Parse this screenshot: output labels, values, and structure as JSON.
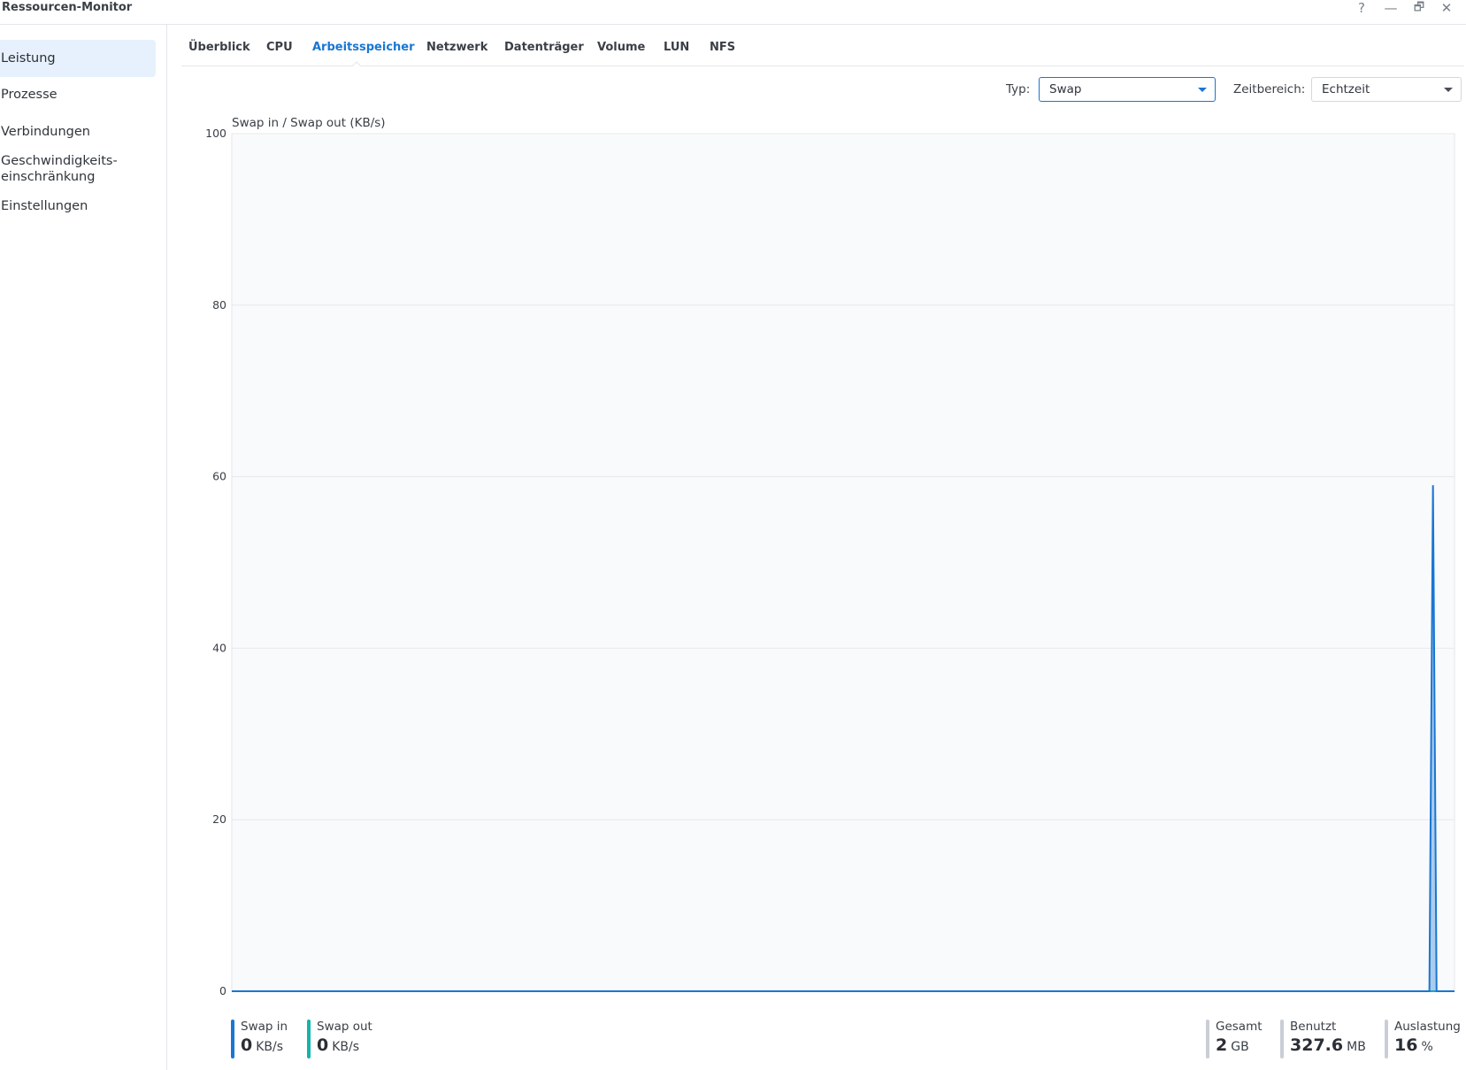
{
  "window": {
    "title": "Ressourcen-Monitor",
    "controls": {
      "help": "?",
      "minimize": "—",
      "restore": "🗗",
      "close": "✕"
    }
  },
  "sidebar": {
    "items": [
      {
        "label": "Leistung",
        "active": true
      },
      {
        "label": "Prozesse"
      },
      {
        "label": "Verbindungen"
      },
      {
        "label": "Geschwindigkeits-\neinschränkung"
      },
      {
        "label": "Einstellungen"
      }
    ]
  },
  "tabs": [
    {
      "label": "Überblick"
    },
    {
      "label": "CPU"
    },
    {
      "label": "Arbeitsspeicher",
      "active": true
    },
    {
      "label": "Netzwerk"
    },
    {
      "label": "Datenträger"
    },
    {
      "label": "Volume"
    },
    {
      "label": "LUN"
    },
    {
      "label": "NFS"
    }
  ],
  "filters": {
    "type_label": "Typ:",
    "type_value": "Swap",
    "range_label": "Zeitbereich:",
    "range_value": "Echtzeit"
  },
  "chart_data": {
    "type": "area",
    "title": "Swap in / Swap out (KB/s)",
    "ylim": [
      0,
      100
    ],
    "yticks": [
      0,
      20,
      40,
      60,
      80,
      100
    ],
    "grid": true,
    "series": [
      {
        "name": "Swap in",
        "color": "#1a76d2",
        "values": [
          0,
          0,
          0,
          0,
          0,
          0,
          0,
          0,
          0,
          0,
          0,
          0,
          0,
          0,
          0,
          0,
          0,
          0,
          0,
          0,
          0,
          0,
          0,
          0,
          0,
          0,
          0,
          0,
          0,
          0,
          0,
          0,
          0,
          0,
          0,
          0,
          0,
          0,
          0,
          0,
          0,
          0,
          0,
          0,
          0,
          0,
          0,
          0,
          0,
          0,
          0,
          0,
          0,
          0,
          0,
          0,
          0,
          0,
          0,
          0,
          0,
          0,
          0,
          0,
          0,
          0,
          0,
          0,
          0,
          0,
          0,
          0,
          0,
          0,
          0,
          0,
          0,
          0,
          0,
          0,
          0,
          0,
          0,
          0,
          0,
          0,
          0,
          0,
          0,
          0,
          0,
          0,
          0,
          0,
          0,
          0,
          0,
          0,
          0,
          0,
          0,
          0,
          0,
          0,
          0,
          0,
          0,
          0,
          0,
          0,
          0,
          0,
          0,
          0,
          0,
          0,
          0,
          0,
          0,
          0,
          0,
          0,
          0,
          0,
          0,
          0,
          0,
          0,
          0,
          0,
          0,
          0,
          0,
          0,
          0,
          0,
          0,
          0,
          0,
          0,
          0,
          0,
          0,
          0,
          0,
          0,
          0,
          0,
          0,
          0,
          0,
          0,
          0,
          0,
          0,
          0,
          0,
          0,
          0,
          0,
          0,
          0,
          0,
          0,
          0,
          0,
          0,
          0,
          0,
          0,
          0,
          0,
          0,
          0,
          0,
          0,
          0,
          0,
          0,
          0,
          0,
          0,
          0,
          0,
          0,
          0,
          0,
          0,
          0,
          0,
          0,
          0,
          0,
          0,
          0,
          0,
          0,
          0,
          0,
          0,
          0,
          0,
          0,
          0,
          0,
          0,
          0,
          0,
          0,
          0,
          0,
          0,
          0,
          0,
          0,
          0,
          0,
          0,
          0,
          0,
          0,
          0,
          0,
          0,
          0,
          0,
          0,
          0,
          0,
          0,
          0,
          0,
          0,
          0,
          0,
          0,
          0,
          0,
          0,
          0,
          0,
          0,
          0,
          0,
          0,
          0,
          0,
          0,
          0,
          0,
          0,
          0,
          0,
          0,
          0,
          0,
          0,
          0,
          0,
          0,
          0,
          0,
          0,
          0,
          0,
          0,
          0,
          0,
          0,
          0,
          0,
          0,
          0,
          0,
          0,
          0,
          0,
          0,
          0,
          0,
          0,
          0,
          0,
          0,
          0,
          0,
          0,
          0,
          0,
          0,
          0,
          0,
          0,
          0,
          0,
          0,
          0,
          0,
          0,
          0,
          0,
          0,
          0,
          0,
          0,
          0,
          0,
          0,
          0,
          0,
          0,
          0,
          0,
          0,
          0,
          0,
          0,
          0,
          0,
          0,
          0,
          0,
          0,
          0,
          0,
          0,
          0,
          0,
          0,
          0,
          0,
          0,
          0,
          0,
          0,
          59,
          0,
          0,
          0,
          0,
          0,
          0
        ]
      },
      {
        "name": "Swap out",
        "color": "#11b5ae",
        "values": [
          0,
          0,
          0,
          0,
          0,
          0,
          0,
          0,
          0,
          0,
          0,
          0,
          0,
          0,
          0,
          0,
          0,
          0,
          0,
          0,
          0,
          0,
          0,
          0,
          0,
          0,
          0,
          0,
          0,
          0,
          0,
          0,
          0,
          0,
          0,
          0,
          0,
          0,
          0,
          0,
          0,
          0,
          0,
          0,
          0,
          0,
          0,
          0,
          0,
          0,
          0,
          0,
          0,
          0,
          0,
          0,
          0,
          0,
          0,
          0,
          0,
          0,
          0,
          0,
          0,
          0,
          0,
          0,
          0,
          0,
          0,
          0,
          0,
          0,
          0,
          0,
          0,
          0,
          0,
          0,
          0,
          0,
          0,
          0,
          0,
          0,
          0,
          0,
          0,
          0,
          0,
          0,
          0,
          0,
          0,
          0,
          0,
          0,
          0,
          0,
          0,
          0,
          0,
          0,
          0,
          0,
          0,
          0,
          0,
          0,
          0,
          0,
          0,
          0,
          0,
          0,
          0,
          0,
          0,
          0,
          0,
          0,
          0,
          0,
          0,
          0,
          0,
          0,
          0,
          0,
          0,
          0,
          0,
          0,
          0,
          0,
          0,
          0,
          0,
          0,
          0,
          0,
          0,
          0,
          0,
          0,
          0,
          0,
          0,
          0,
          0,
          0,
          0,
          0,
          0,
          0,
          0,
          0,
          0,
          0,
          0,
          0,
          0,
          0,
          0,
          0,
          0,
          0,
          0,
          0,
          0,
          0,
          0,
          0,
          0,
          0,
          0,
          0,
          0,
          0,
          0,
          0,
          0,
          0,
          0,
          0,
          0,
          0,
          0,
          0,
          0,
          0,
          0,
          0,
          0,
          0,
          0,
          0,
          0,
          0,
          0,
          0,
          0,
          0,
          0,
          0,
          0,
          0,
          0,
          0,
          0,
          0,
          0,
          0,
          0,
          0,
          0,
          0,
          0,
          0,
          0,
          0,
          0,
          0,
          0,
          0,
          0,
          0,
          0,
          0,
          0,
          0,
          0,
          0,
          0,
          0,
          0,
          0,
          0,
          0,
          0,
          0,
          0,
          0,
          0,
          0,
          0,
          0,
          0,
          0,
          0,
          0,
          0,
          0,
          0,
          0,
          0,
          0,
          0,
          0,
          0,
          0,
          0,
          0,
          0,
          0,
          0,
          0,
          0,
          0,
          0,
          0,
          0,
          0,
          0,
          0,
          0,
          0,
          0,
          0,
          0,
          0,
          0,
          0,
          0,
          0,
          0,
          0,
          0,
          0,
          0,
          0,
          0,
          0,
          0,
          0,
          0,
          0,
          0,
          0,
          0,
          0,
          0,
          0,
          0,
          0,
          0,
          0,
          0,
          0,
          0,
          0,
          0,
          0,
          0,
          0,
          0,
          0,
          0,
          0,
          0,
          0,
          0,
          0,
          0,
          0,
          0,
          0,
          0,
          0,
          0,
          0,
          0,
          0,
          0,
          0,
          0,
          0,
          0,
          0,
          0,
          0,
          0,
          0
        ]
      }
    ]
  },
  "legend": {
    "swap_in": {
      "label": "Swap in",
      "value": "0",
      "unit": "KB/s",
      "color": "#1a76d2"
    },
    "swap_out": {
      "label": "Swap out",
      "value": "0",
      "unit": "KB/s",
      "color": "#11b5ae"
    }
  },
  "stats": {
    "total": {
      "label": "Gesamt",
      "value": "2",
      "unit": "GB"
    },
    "used": {
      "label": "Benutzt",
      "value": "327.6",
      "unit": "MB"
    },
    "usage": {
      "label": "Auslastung",
      "value": "16",
      "unit": "%"
    }
  }
}
